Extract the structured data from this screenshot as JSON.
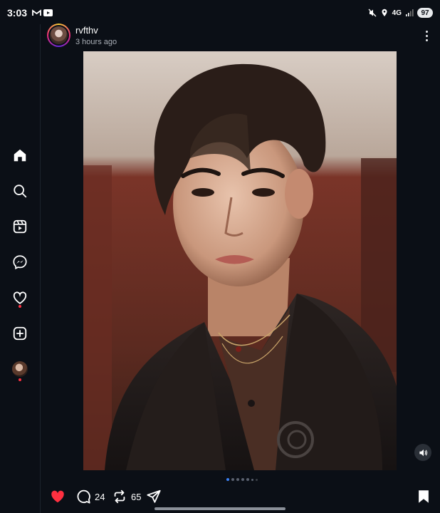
{
  "status_bar": {
    "time": "3:03",
    "network": "4G",
    "battery": "97"
  },
  "post": {
    "username": "rvfthv",
    "timestamp": "3 hours ago",
    "carousel": {
      "total": 7,
      "active_index": 0
    },
    "actions": {
      "comment_count": "24",
      "repost_count": "65",
      "liked": true
    }
  },
  "sidebar": {
    "items": [
      "home-icon",
      "search-icon",
      "reels-icon",
      "messenger-icon",
      "activity-heart-icon",
      "create-icon",
      "profile-avatar"
    ]
  },
  "colors": {
    "background": "#0b0f16",
    "like_red": "#ff3040",
    "active_dot": "#3b82f6"
  }
}
